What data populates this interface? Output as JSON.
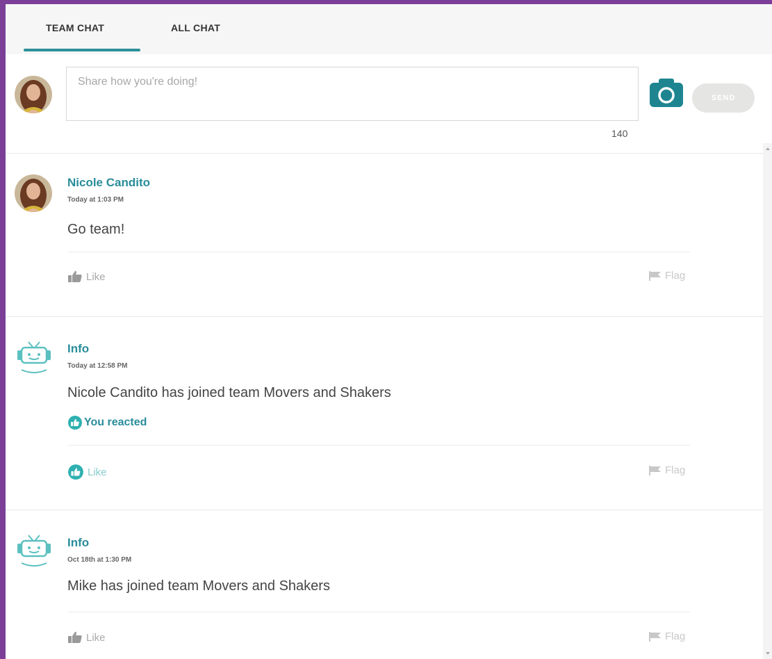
{
  "tabs": {
    "team_chat": "TEAM CHAT",
    "all_chat": "ALL CHAT"
  },
  "composer": {
    "placeholder": "Share how you're doing!",
    "char_count": "140",
    "send_label": "SEND"
  },
  "posts": [
    {
      "author": "Nicole Candito",
      "time": "Today at 1:03 PM",
      "text": "Go team!",
      "like": "Like",
      "flag": "Flag"
    },
    {
      "author": "Info",
      "time": "Today at 12:58 PM",
      "text": "Nicole Candito has joined team Movers and Shakers",
      "reaction": "You reacted",
      "like": "Like",
      "flag": "Flag"
    },
    {
      "author": "Info",
      "time": "Oct 18th at 1:30 PM",
      "text": "Mike has joined team Movers and Shakers",
      "like": "Like",
      "flag": "Flag"
    }
  ],
  "colors": {
    "frame": "#7b3f98",
    "accent": "#2d8f9b",
    "send_disabled": "#e5e5e3"
  },
  "icons": [
    "camera-icon",
    "thumbs-up-icon",
    "flag-icon",
    "bot-avatar-icon",
    "reaction-like-icon"
  ]
}
